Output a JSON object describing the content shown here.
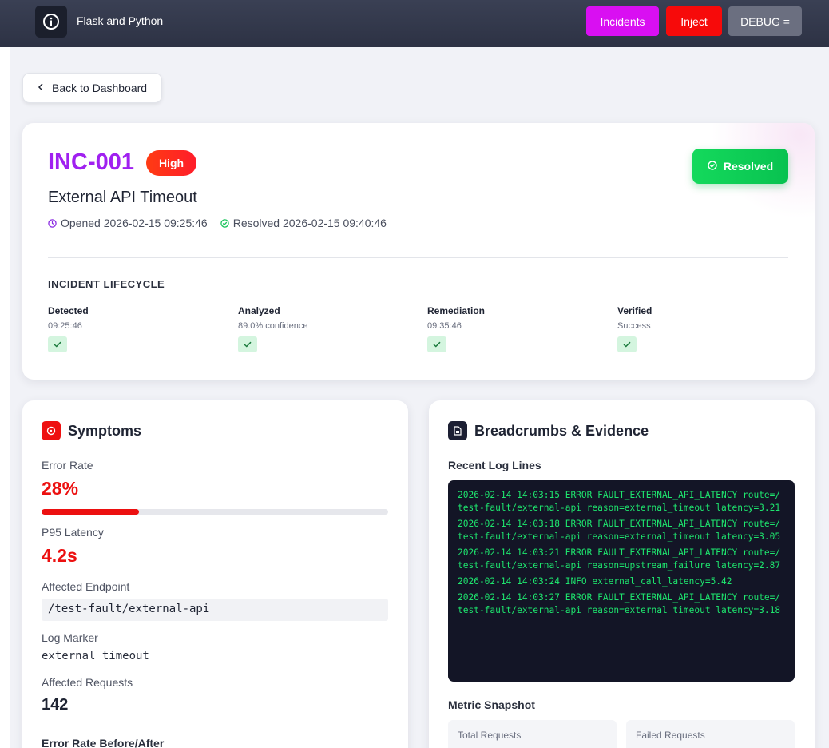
{
  "header": {
    "brand_title": "Flask and Python",
    "nav": {
      "incidents": "Incidents",
      "inject": "Inject",
      "debug": "DEBUG ="
    },
    "colors": {
      "incidents": "#d90ff2",
      "inject": "#f70a0a",
      "debug": "#6b6f80"
    }
  },
  "back_button": {
    "label": "Back to Dashboard"
  },
  "incident": {
    "id": "INC-001",
    "severity": "High",
    "status": "Resolved",
    "title": "External API Timeout",
    "opened": "Opened 2026-02-15 09:25:46",
    "resolved": "Resolved 2026-02-15 09:40:46",
    "lifecycle_label": "INCIDENT LIFECYCLE",
    "stages": [
      {
        "name": "Detected",
        "sub": "09:25:46"
      },
      {
        "name": "Analyzed",
        "sub": "89.0% confidence"
      },
      {
        "name": "Remediation",
        "sub": "09:35:46"
      },
      {
        "name": "Verified",
        "sub": "Success"
      }
    ]
  },
  "symptoms": {
    "title": "Symptoms",
    "error_rate_label": "Error Rate",
    "error_rate": "28%",
    "error_rate_fraction": 0.28,
    "p95_label": "P95 Latency",
    "p95": "4.2s",
    "endpoint_label": "Affected Endpoint",
    "endpoint": "/test-fault/external-api",
    "log_marker_label": "Log Marker",
    "log_marker": "external_timeout",
    "affected_requests_label": "Affected Requests",
    "affected_requests": "142",
    "before_after_label": "Error Rate Before/After"
  },
  "evidence": {
    "title": "Breadcrumbs & Evidence",
    "log_lines_label": "Recent Log Lines",
    "log_lines": [
      "2026-02-14 14:03:15 ERROR FAULT_EXTERNAL_API_LATENCY route=/test-fault/external-api reason=external_timeout latency=3.21",
      "2026-02-14 14:03:18 ERROR FAULT_EXTERNAL_API_LATENCY route=/test-fault/external-api reason=external_timeout latency=3.05",
      "2026-02-14 14:03:21 ERROR FAULT_EXTERNAL_API_LATENCY route=/test-fault/external-api reason=upstream_failure latency=2.87",
      "2026-02-14 14:03:24 INFO external_call_latency=5.42",
      "2026-02-14 14:03:27 ERROR FAULT_EXTERNAL_API_LATENCY route=/test-fault/external-api reason=external_timeout latency=3.18"
    ],
    "metric_snapshot_label": "Metric Snapshot",
    "metrics": [
      {
        "label": "Total Requests"
      },
      {
        "label": "Failed Requests"
      }
    ]
  },
  "icons": {
    "brand": "info-circle-icon",
    "back": "chevron-left-icon",
    "opened": "clock-icon",
    "resolved": "check-circle-icon",
    "stage_check": "check-icon",
    "symptoms": "alert-circle-icon",
    "evidence": "document-icon"
  }
}
